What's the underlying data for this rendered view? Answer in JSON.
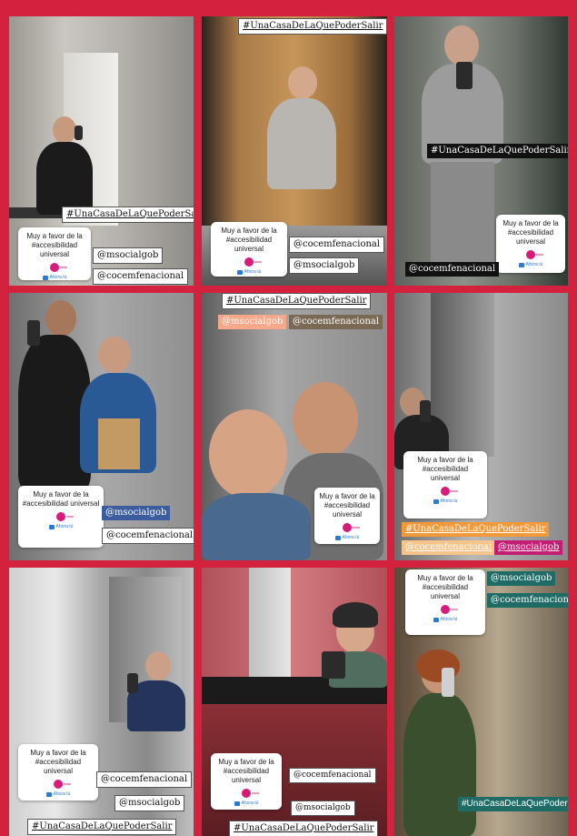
{
  "hashtag": "#UnaCasaDeLaQuePoderSalir",
  "handles": {
    "msocial": "@msocialgob",
    "cocemfe": "@cocemfenacional"
  },
  "poll": {
    "question": "Muy a favor de la #accesibilidad universal",
    "footer": "Ahora tú"
  },
  "colors": {
    "background": "#d4213d",
    "poll_slider": "#d81b7a",
    "poll_link": "#2a7bd6"
  }
}
